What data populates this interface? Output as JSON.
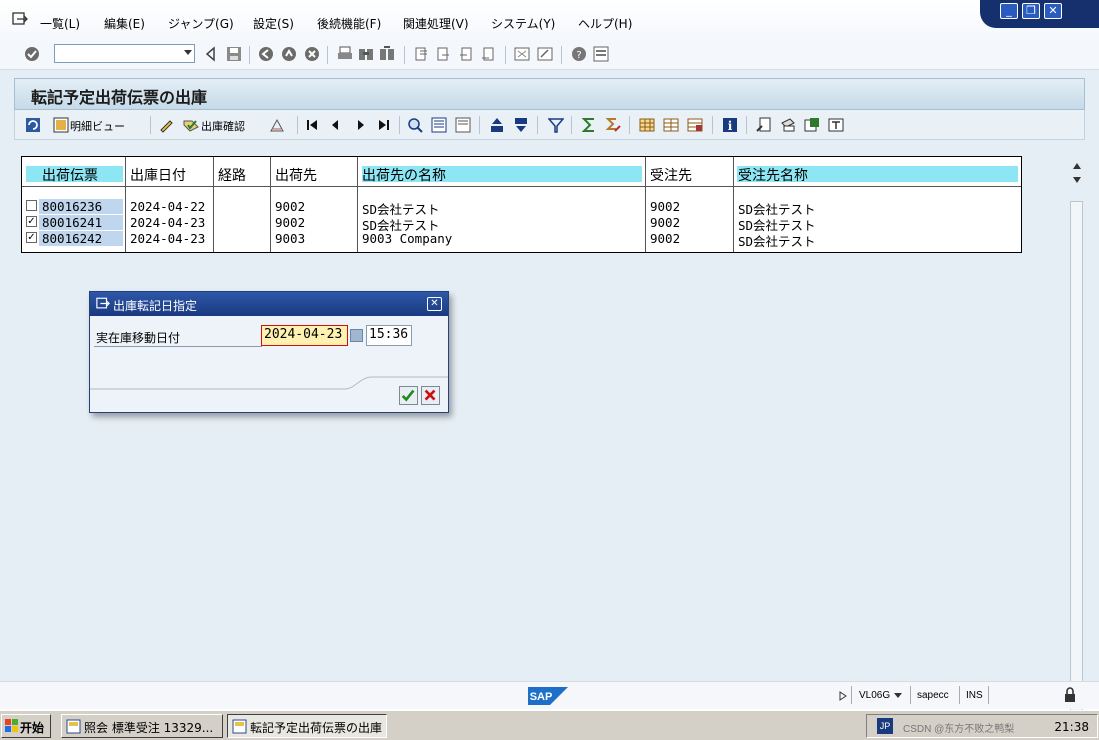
{
  "menu": {
    "items": [
      "一覧(L)",
      "編集(E)",
      "ジャンプ(G)",
      "設定(S)",
      "後続機能(F)",
      "関連処理(V)",
      "システム(Y)",
      "ヘルプ(H)"
    ]
  },
  "window_controls": {
    "minimize": "_",
    "restore": "❐",
    "close": "✕"
  },
  "command_field": {
    "value": ""
  },
  "screen": {
    "title": "転記予定出荷伝票の出庫",
    "toolbar": {
      "detail_view_label": "明細ビュー",
      "ship_confirm_label": "出庫確認"
    }
  },
  "table": {
    "columns": [
      "出荷伝票",
      "出庫日付",
      "経路",
      "出荷先",
      "出荷先の名称",
      "受注先",
      "受注先名称"
    ],
    "rows": [
      {
        "checked": false,
        "doc": "80016236",
        "date": "2024-04-22",
        "route": "",
        "ship_to": "9002",
        "ship_to_name": "SD会社テスト",
        "sold_to": "9002",
        "sold_to_name": "SD会社テスト"
      },
      {
        "checked": true,
        "doc": "80016241",
        "date": "2024-04-23",
        "route": "",
        "ship_to": "9002",
        "ship_to_name": "SD会社テスト",
        "sold_to": "9002",
        "sold_to_name": "SD会社テスト"
      },
      {
        "checked": true,
        "doc": "80016242",
        "date": "2024-04-23",
        "route": "",
        "ship_to": "9003",
        "ship_to_name": "9003 Company",
        "sold_to": "9002",
        "sold_to_name": "SD会社テスト"
      }
    ]
  },
  "dialog": {
    "title": "出庫転記日指定",
    "field_label": "実在庫移動日付",
    "date_value": "2024-04-23",
    "time_value": "15:36"
  },
  "status": {
    "logo": "SAP",
    "transaction": "VL06G",
    "system": "sapecc",
    "mode": "INS"
  },
  "taskbar": {
    "start_label": "开始",
    "tasks": [
      "照会 標準受注 13329...",
      "転記予定出荷伝票の出庫"
    ],
    "lang": "JP",
    "clock": "21:38",
    "watermark": "CSDN @东方不败之鸭梨"
  }
}
